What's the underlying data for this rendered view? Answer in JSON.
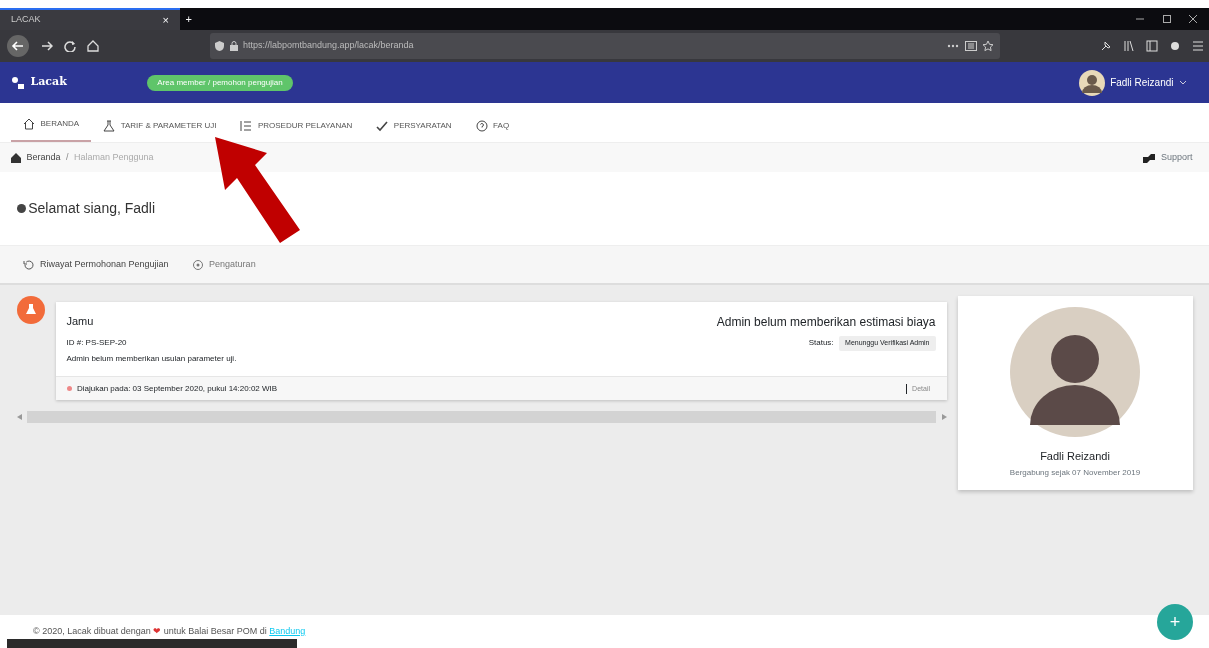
{
  "browser": {
    "tab_title": "LACAK",
    "url": "https://labpomtbandung.app/lacak/beranda",
    "tab_close": "×",
    "new_tab": "+"
  },
  "app_bar": {
    "brand": "Lacak",
    "badge": "Area member / pemohon pengujian",
    "user": "Fadli Reizandi"
  },
  "nav": [
    {
      "label": "BERANDA",
      "kind": "home",
      "selected": true
    },
    {
      "label": "TARIF & PARAMETER UJI",
      "kind": "flask",
      "selected": false
    },
    {
      "label": "PROSEDUR PELAYANAN",
      "kind": "list",
      "selected": false
    },
    {
      "label": "PERSYARATAN",
      "kind": "check",
      "selected": false
    },
    {
      "label": "FAQ",
      "kind": "help",
      "selected": false
    }
  ],
  "breadcrumb": [
    "Beranda",
    "Halaman Pengguna"
  ],
  "breadcrumb_separator": "/",
  "support": "Support",
  "greeting": "Selamat siang, Fadli",
  "sub_tabs": [
    {
      "label": "Riwayat Permohonan Pengujian",
      "kind": "history",
      "selected": true
    },
    {
      "label": "Pengaturan",
      "kind": "settings",
      "selected": false
    }
  ],
  "requests": [
    {
      "title": "Jamu",
      "estimate": "Admin belum memberikan estimasi biaya",
      "id": "ID #: PS-SEP-20",
      "status_label": "Status:",
      "status": "Menunggu Verifikasi Admin",
      "note": "Admin belum memberikan usulan parameter uji.",
      "submitted": "Diajukan pada: 03 September 2020, pukul 14:20:02 WIB",
      "detail": "Detail"
    }
  ],
  "profile": {
    "name": "Fadli Reizandi",
    "joined": "Bergabung sejak 07 November 2019"
  },
  "footer": {
    "before": "© 2020, Lacak dibuat dengan",
    "heart": "❤",
    "after": "untuk Balai Besar POM di",
    "link": "Bandung"
  },
  "fab": "+"
}
